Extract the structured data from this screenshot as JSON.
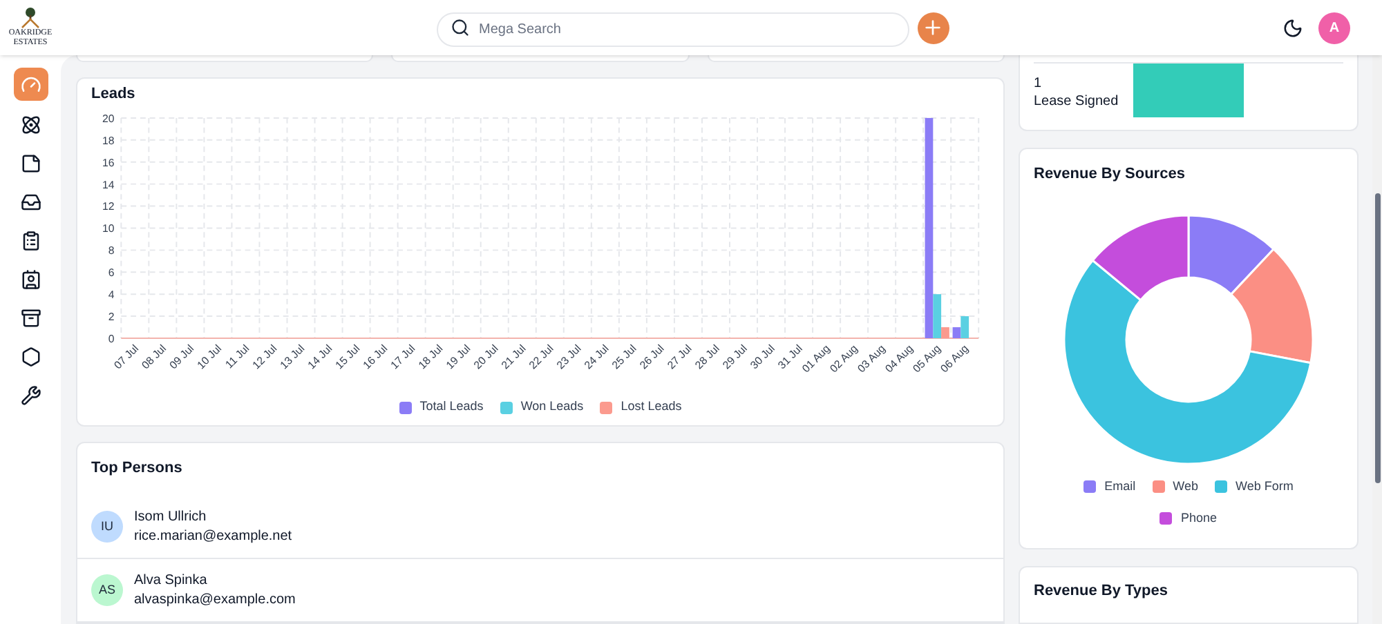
{
  "header": {
    "logo": {
      "line1": "OAKRIDGE",
      "line2": "ESTATES"
    },
    "search": {
      "placeholder": "Mega Search"
    },
    "avatar": "A"
  },
  "sidebar": {
    "items": [
      {
        "kind": "gauge",
        "selected": true
      },
      {
        "kind": "atom",
        "selected": false
      },
      {
        "kind": "note",
        "selected": false
      },
      {
        "kind": "inbox",
        "selected": false
      },
      {
        "kind": "clipboard",
        "selected": false
      },
      {
        "kind": "contacts",
        "selected": false
      },
      {
        "kind": "archive",
        "selected": false
      },
      {
        "kind": "hexagon",
        "selected": false
      },
      {
        "kind": "wrench",
        "selected": false
      }
    ]
  },
  "leads": {
    "title": "Leads",
    "chart_data": {
      "type": "bar",
      "categories": [
        "07 Jul",
        "08 Jul",
        "09 Jul",
        "10 Jul",
        "11 Jul",
        "12 Jul",
        "13 Jul",
        "14 Jul",
        "15 Jul",
        "16 Jul",
        "17 Jul",
        "18 Jul",
        "19 Jul",
        "20 Jul",
        "21 Jul",
        "22 Jul",
        "23 Jul",
        "24 Jul",
        "25 Jul",
        "26 Jul",
        "27 Jul",
        "28 Jul",
        "29 Jul",
        "30 Jul",
        "31 Jul",
        "01 Aug",
        "02 Aug",
        "03 Aug",
        "04 Aug",
        "05 Aug",
        "06 Aug"
      ],
      "series": [
        {
          "name": "Total Leads",
          "color": "#8b7cf6",
          "values": [
            0,
            0,
            0,
            0,
            0,
            0,
            0,
            0,
            0,
            0,
            0,
            0,
            0,
            0,
            0,
            0,
            0,
            0,
            0,
            0,
            0,
            0,
            0,
            0,
            0,
            0,
            0,
            0,
            0,
            20,
            1
          ]
        },
        {
          "name": "Won Leads",
          "color": "#5ad0e2",
          "values": [
            0,
            0,
            0,
            0,
            0,
            0,
            0,
            0,
            0,
            0,
            0,
            0,
            0,
            0,
            0,
            0,
            0,
            0,
            0,
            0,
            0,
            0,
            0,
            0,
            0,
            0,
            0,
            0,
            0,
            4,
            2
          ]
        },
        {
          "name": "Lost Leads",
          "color": "#fb9a8e",
          "values": [
            0,
            0,
            0,
            0,
            0,
            0,
            0,
            0,
            0,
            0,
            0,
            0,
            0,
            0,
            0,
            0,
            0,
            0,
            0,
            0,
            0,
            0,
            0,
            0,
            0,
            0,
            0,
            0,
            0,
            1,
            0
          ]
        }
      ],
      "grid": true,
      "legend": true,
      "ylim": [
        0,
        20
      ],
      "yticks": [
        0,
        2,
        4,
        6,
        8,
        10,
        12,
        14,
        16,
        18,
        20
      ]
    }
  },
  "top_persons": {
    "title": "Top Persons",
    "rows": [
      {
        "initials": "IU",
        "name": "Isom Ullrich",
        "email": "rice.marian@example.net",
        "color": "#bfdbfe"
      },
      {
        "initials": "AS",
        "name": "Alva Spinka",
        "email": "alvaspinka@example.com",
        "color": "#bbf7d0"
      }
    ]
  },
  "lease": {
    "count": "1",
    "label": "Lease Signed"
  },
  "revenue_sources": {
    "title": "Revenue By Sources",
    "legend": [
      {
        "label": "Email",
        "color": "#8b7cf6"
      },
      {
        "label": "Web",
        "color": "#fb8f84"
      },
      {
        "label": "Web Form",
        "color": "#3bc3df"
      },
      {
        "label": "Phone",
        "color": "#c44ddc"
      }
    ]
  },
  "revenue_types": {
    "title": "Revenue By Types"
  }
}
